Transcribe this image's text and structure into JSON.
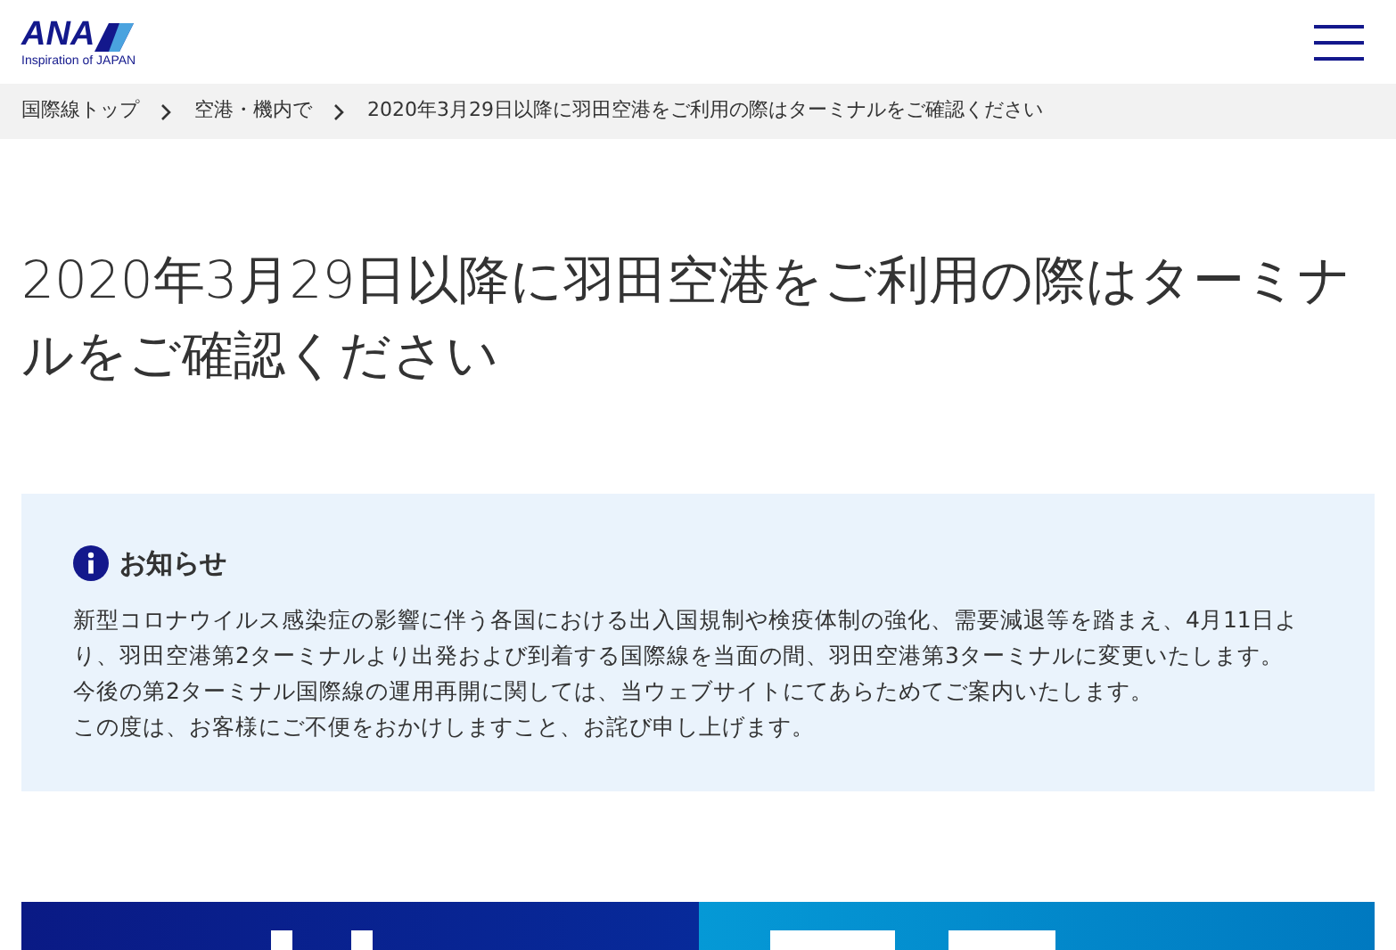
{
  "header": {
    "logo": {
      "name": "ANA",
      "tagline": "Inspiration of JAPAN"
    }
  },
  "breadcrumb": [
    "国際線トップ",
    "空港・機内で",
    "2020年3月29日以降に羽田空港をご利用の際はターミナルをご確認ください"
  ],
  "page_title": "2020年3月29日以降に羽田空港をご利用の際はターミナルをご確認ください",
  "notice": {
    "title": "お知らせ",
    "paragraphs": [
      "新型コロナウイルス感染症の影響に伴う各国における出入国規制や検疫体制の強化、需要減退等を踏まえ、4月11日より、羽田空港第2ターミナルより出発および到着する国際線を当面の間、羽田空港第3ターミナルに変更いたします。",
      "今後の第2ターミナル国際線の運用再開に関しては、当ウェブサイトにてあらためてご案内いたします。",
      "この度は、お客様にご不便をおかけしますこと、お詫び申し上げます。"
    ]
  }
}
